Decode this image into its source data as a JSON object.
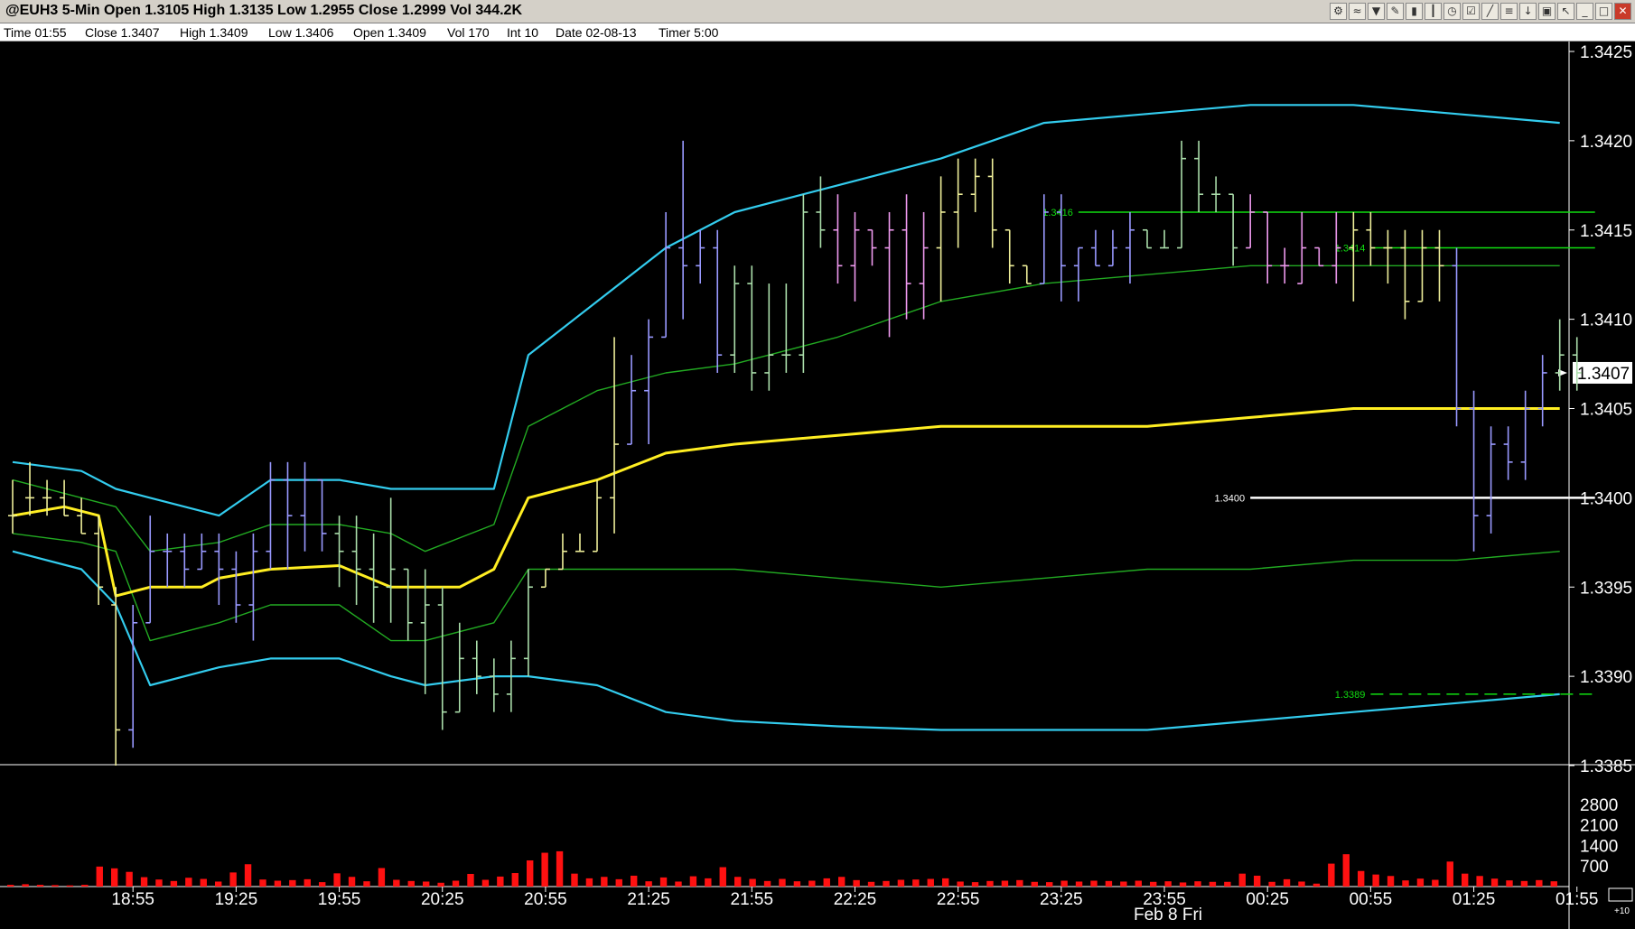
{
  "window": {
    "title": "@EUH3 5-Min Open 1.3105 High 1.3135 Low 1.2955 Close 1.2999 Vol 344.2K",
    "toolbar_icons": [
      "network-icon",
      "wave-icon",
      "filter-icon",
      "pencil-icon",
      "bar-chart-icon",
      "candlestick-icon",
      "clock-icon",
      "checklist-icon",
      "trendline-icon",
      "fib-icon",
      "down-arrow-icon",
      "trash-icon",
      "pointer-icon"
    ],
    "window_buttons": [
      "minimize-icon",
      "restore-icon",
      "close-icon"
    ]
  },
  "info": {
    "time": "Time 01:55",
    "close": "Close 1.3407",
    "high": "High 1.3409",
    "low": "Low 1.3406",
    "open": "Open 1.3409",
    "vol": "Vol 170",
    "int": "Int 10",
    "date": "Date 02-08-13",
    "timer": "Timer 5:00"
  },
  "colors": {
    "bg": "#000000",
    "cyan": "#33ccee",
    "green": "#22aa22",
    "yellow": "#ffee22",
    "bar_pink": "#ee99ee",
    "bar_blue": "#9999ff",
    "bar_yellow": "#eeee99",
    "bar_green": "#aaddaa",
    "volume": "#ff1111",
    "level_green": "#11dd11",
    "level_white": "#ffffff"
  },
  "chart_data": {
    "type": "ohlc",
    "ylim": [
      1.3385,
      1.3425
    ],
    "y_ticks": [
      "1.3425",
      "1.3420",
      "1.3415",
      "1.3410",
      "1.3405",
      "1.3400",
      "1.3395",
      "1.3390",
      "1.3385"
    ],
    "x_ticks": [
      "18:55",
      "19:25",
      "19:55",
      "20:25",
      "20:55",
      "21:25",
      "21:55",
      "22:25",
      "22:55",
      "23:25",
      "23:55",
      "00:25",
      "00:55",
      "01:25",
      "01:55"
    ],
    "x_tick_index": [
      7,
      13,
      19,
      25,
      31,
      37,
      43,
      49,
      55,
      61,
      67,
      73,
      79,
      85,
      91
    ],
    "date_label": "Feb 8 Fri",
    "last_price": "1.3407",
    "volume_ticks": [
      "2800",
      "2100",
      "1400",
      "700"
    ],
    "volume_ylim": [
      0,
      3500
    ],
    "corner_label": "+10",
    "bar_colors": "AAAAAAABBBBBBBBBBBBCCCCCCCCCCCCDDDDDDDDDDDDDDDDDDDDDDDDDDDDDDDDDDDDDDDDDDDDDDDDDDDDDDDDDDDD",
    "bars": [
      [
        1.3399,
        1.3401,
        1.3398,
        1.3399
      ],
      [
        1.34,
        1.3402,
        1.3399,
        1.34
      ],
      [
        1.34,
        1.3401,
        1.3399,
        1.34
      ],
      [
        1.34,
        1.3401,
        1.3399,
        1.3399
      ],
      [
        1.3399,
        1.34,
        1.3398,
        1.3398
      ],
      [
        1.3398,
        1.3399,
        1.3394,
        1.3395
      ],
      [
        1.3394,
        1.3395,
        1.3385,
        1.3387
      ],
      [
        1.3387,
        1.3394,
        1.3386,
        1.3393
      ],
      [
        1.3393,
        1.3399,
        1.3393,
        1.3397
      ],
      [
        1.3397,
        1.3398,
        1.3395,
        1.3397
      ],
      [
        1.3397,
        1.3398,
        1.3395,
        1.3396
      ],
      [
        1.3396,
        1.3398,
        1.3396,
        1.3397
      ],
      [
        1.3397,
        1.3398,
        1.3394,
        1.3396
      ],
      [
        1.3396,
        1.3397,
        1.3393,
        1.3394
      ],
      [
        1.3394,
        1.3398,
        1.3392,
        1.3397
      ],
      [
        1.3397,
        1.3402,
        1.3396,
        1.3401
      ],
      [
        1.3401,
        1.3402,
        1.3396,
        1.3399
      ],
      [
        1.3399,
        1.3402,
        1.3397,
        1.3401
      ],
      [
        1.3401,
        1.3401,
        1.3397,
        1.3398
      ],
      [
        1.3398,
        1.3399,
        1.3395,
        1.3397
      ],
      [
        1.3397,
        1.3399,
        1.3394,
        1.3396
      ],
      [
        1.3396,
        1.3398,
        1.3393,
        1.3395
      ],
      [
        1.3395,
        1.34,
        1.3393,
        1.3396
      ],
      [
        1.3396,
        1.3396,
        1.3392,
        1.3393
      ],
      [
        1.3393,
        1.3396,
        1.3389,
        1.3394
      ],
      [
        1.3394,
        1.3395,
        1.3387,
        1.3388
      ],
      [
        1.3388,
        1.3393,
        1.3388,
        1.3391
      ],
      [
        1.3391,
        1.3392,
        1.3389,
        1.339
      ],
      [
        1.339,
        1.3391,
        1.3388,
        1.3389
      ],
      [
        1.3389,
        1.3392,
        1.3388,
        1.3391
      ],
      [
        1.3391,
        1.3396,
        1.339,
        1.3395
      ],
      [
        1.3395,
        1.3396,
        1.3395,
        1.3396
      ],
      [
        1.3396,
        1.3398,
        1.3396,
        1.3397
      ],
      [
        1.3397,
        1.3398,
        1.3397,
        1.3397
      ],
      [
        1.3397,
        1.3401,
        1.3397,
        1.34
      ],
      [
        1.34,
        1.3409,
        1.3398,
        1.3403
      ],
      [
        1.3403,
        1.3408,
        1.3403,
        1.3406
      ],
      [
        1.3406,
        1.341,
        1.3403,
        1.3409
      ],
      [
        1.3409,
        1.3416,
        1.3409,
        1.3414
      ],
      [
        1.3414,
        1.342,
        1.341,
        1.3413
      ],
      [
        1.3413,
        1.3415,
        1.3412,
        1.3414
      ],
      [
        1.3414,
        1.3415,
        1.3407,
        1.3408
      ],
      [
        1.3408,
        1.3413,
        1.3407,
        1.3412
      ],
      [
        1.3412,
        1.3413,
        1.3406,
        1.3407
      ],
      [
        1.3407,
        1.3412,
        1.3406,
        1.3408
      ],
      [
        1.3408,
        1.3412,
        1.3407,
        1.3408
      ],
      [
        1.3408,
        1.3417,
        1.3407,
        1.3416
      ],
      [
        1.3416,
        1.3418,
        1.3414,
        1.3415
      ],
      [
        1.3415,
        1.3417,
        1.3412,
        1.3413
      ],
      [
        1.3413,
        1.3416,
        1.3411,
        1.3415
      ],
      [
        1.3415,
        1.3415,
        1.3413,
        1.3414
      ],
      [
        1.3414,
        1.3416,
        1.3409,
        1.3415
      ],
      [
        1.3415,
        1.3417,
        1.341,
        1.3412
      ],
      [
        1.3412,
        1.3416,
        1.341,
        1.3414
      ],
      [
        1.3414,
        1.3418,
        1.3411,
        1.3416
      ],
      [
        1.3416,
        1.3419,
        1.3414,
        1.3417
      ],
      [
        1.3417,
        1.3419,
        1.3416,
        1.3418
      ],
      [
        1.3418,
        1.3419,
        1.3414,
        1.3415
      ],
      [
        1.3415,
        1.3415,
        1.3412,
        1.3413
      ],
      [
        1.3413,
        1.3413,
        1.3412,
        1.3412
      ],
      [
        1.3412,
        1.3417,
        1.3412,
        1.3416
      ],
      [
        1.3416,
        1.3417,
        1.3411,
        1.3413
      ],
      [
        1.3413,
        1.3414,
        1.3411,
        1.3414
      ],
      [
        1.3414,
        1.3415,
        1.3413,
        1.3413
      ],
      [
        1.3413,
        1.3415,
        1.3413,
        1.3414
      ],
      [
        1.3414,
        1.3416,
        1.3412,
        1.3415
      ],
      [
        1.3415,
        1.3415,
        1.3414,
        1.3414
      ],
      [
        1.3414,
        1.3415,
        1.3414,
        1.3414
      ],
      [
        1.3414,
        1.342,
        1.3414,
        1.3419
      ],
      [
        1.3419,
        1.342,
        1.3416,
        1.3417
      ],
      [
        1.3417,
        1.3418,
        1.3416,
        1.3417
      ],
      [
        1.3417,
        1.3417,
        1.3413,
        1.3414
      ],
      [
        1.3414,
        1.3417,
        1.3414,
        1.3416
      ],
      [
        1.3416,
        1.3416,
        1.3412,
        1.3413
      ],
      [
        1.3413,
        1.3414,
        1.3412,
        1.3413
      ],
      [
        1.3412,
        1.3416,
        1.3412,
        1.3414
      ],
      [
        1.3414,
        1.3414,
        1.3413,
        1.3413
      ],
      [
        1.3413,
        1.3416,
        1.3412,
        1.3414
      ],
      [
        1.3414,
        1.3416,
        1.3411,
        1.3415
      ],
      [
        1.3415,
        1.3416,
        1.3413,
        1.3414
      ],
      [
        1.3414,
        1.3415,
        1.3412,
        1.3414
      ],
      [
        1.3414,
        1.3415,
        1.341,
        1.3411
      ],
      [
        1.3411,
        1.3415,
        1.3411,
        1.3414
      ],
      [
        1.3414,
        1.3415,
        1.3411,
        1.3413
      ],
      [
        1.3413,
        1.3414,
        1.3404,
        1.3405
      ],
      [
        1.3405,
        1.3406,
        1.3397,
        1.3399
      ],
      [
        1.3399,
        1.3404,
        1.3398,
        1.3403
      ],
      [
        1.3403,
        1.3404,
        1.3401,
        1.3402
      ],
      [
        1.3402,
        1.3406,
        1.3401,
        1.3405
      ],
      [
        1.3405,
        1.3408,
        1.3404,
        1.3407
      ],
      [
        1.3407,
        1.341,
        1.3406,
        1.3408
      ],
      [
        1.3408,
        1.3409,
        1.3406,
        1.3407
      ]
    ],
    "volume": [
      60,
      80,
      60,
      50,
      40,
      60,
      680,
      620,
      500,
      320,
      240,
      190,
      300,
      260,
      170,
      480,
      760,
      240,
      200,
      220,
      250,
      150,
      450,
      330,
      180,
      630,
      230,
      190,
      170,
      130,
      200,
      430,
      230,
      340,
      460,
      890,
      1150,
      1200,
      440,
      280,
      330,
      250,
      370,
      180,
      310,
      170,
      350,
      280,
      660,
      330,
      260,
      190,
      260,
      180,
      200,
      280,
      330,
      220,
      160,
      190,
      230,
      240,
      260,
      280,
      170,
      150,
      190,
      200,
      220,
      160,
      150,
      200,
      170,
      200,
      190,
      170,
      200,
      160,
      180,
      140,
      180,
      160,
      160,
      440,
      370,
      160,
      250,
      170,
      100,
      780,
      1100,
      530,
      410,
      360,
      210,
      270,
      230,
      850,
      440,
      360,
      270,
      210,
      190,
      220,
      180
    ],
    "ma_mid": [
      [
        0,
        1.3399
      ],
      [
        3,
        1.33995
      ],
      [
        5,
        1.3399
      ],
      [
        6,
        1.33945
      ],
      [
        8,
        1.3395
      ],
      [
        11,
        1.3395
      ],
      [
        12,
        1.33955
      ],
      [
        15,
        1.3396
      ],
      [
        19,
        1.33962
      ],
      [
        22,
        1.3395
      ],
      [
        24,
        1.3395
      ],
      [
        26,
        1.3395
      ],
      [
        28,
        1.3396
      ],
      [
        30,
        1.34
      ],
      [
        34,
        1.3401
      ],
      [
        38,
        1.34025
      ],
      [
        42,
        1.3403
      ],
      [
        48,
        1.34035
      ],
      [
        54,
        1.3404
      ],
      [
        60,
        1.3404
      ],
      [
        66,
        1.3404
      ],
      [
        72,
        1.34045
      ],
      [
        78,
        1.3405
      ],
      [
        84,
        1.3405
      ],
      [
        90,
        1.3405
      ]
    ],
    "bb_inner_upper": [
      [
        0,
        1.3401
      ],
      [
        4,
        1.34
      ],
      [
        6,
        1.33995
      ],
      [
        8,
        1.3397
      ],
      [
        12,
        1.33975
      ],
      [
        15,
        1.33985
      ],
      [
        19,
        1.33985
      ],
      [
        22,
        1.3398
      ],
      [
        24,
        1.3397
      ],
      [
        28,
        1.33985
      ],
      [
        30,
        1.3404
      ],
      [
        34,
        1.3406
      ],
      [
        38,
        1.3407
      ],
      [
        42,
        1.34075
      ],
      [
        48,
        1.3409
      ],
      [
        54,
        1.3411
      ],
      [
        60,
        1.3412
      ],
      [
        66,
        1.34125
      ],
      [
        72,
        1.3413
      ],
      [
        78,
        1.3413
      ],
      [
        84,
        1.3413
      ],
      [
        90,
        1.3413
      ]
    ],
    "bb_inner_lower": [
      [
        0,
        1.3398
      ],
      [
        4,
        1.33975
      ],
      [
        6,
        1.3397
      ],
      [
        8,
        1.3392
      ],
      [
        12,
        1.3393
      ],
      [
        15,
        1.3394
      ],
      [
        19,
        1.3394
      ],
      [
        22,
        1.3392
      ],
      [
        24,
        1.3392
      ],
      [
        28,
        1.3393
      ],
      [
        30,
        1.3396
      ],
      [
        34,
        1.3396
      ],
      [
        38,
        1.3396
      ],
      [
        42,
        1.3396
      ],
      [
        48,
        1.33955
      ],
      [
        54,
        1.3395
      ],
      [
        60,
        1.33955
      ],
      [
        66,
        1.3396
      ],
      [
        72,
        1.3396
      ],
      [
        78,
        1.33965
      ],
      [
        84,
        1.33965
      ],
      [
        90,
        1.3397
      ]
    ],
    "bb_outer_upper": [
      [
        0,
        1.3402
      ],
      [
        4,
        1.34015
      ],
      [
        6,
        1.34005
      ],
      [
        8,
        1.34
      ],
      [
        12,
        1.3399
      ],
      [
        15,
        1.3401
      ],
      [
        19,
        1.3401
      ],
      [
        22,
        1.34005
      ],
      [
        24,
        1.34005
      ],
      [
        28,
        1.34005
      ],
      [
        30,
        1.3408
      ],
      [
        34,
        1.3411
      ],
      [
        38,
        1.3414
      ],
      [
        42,
        1.3416
      ],
      [
        48,
        1.34175
      ],
      [
        54,
        1.3419
      ],
      [
        60,
        1.3421
      ],
      [
        66,
        1.34215
      ],
      [
        72,
        1.3422
      ],
      [
        78,
        1.3422
      ],
      [
        84,
        1.34215
      ],
      [
        90,
        1.3421
      ]
    ],
    "bb_outer_lower": [
      [
        0,
        1.3397
      ],
      [
        4,
        1.3396
      ],
      [
        6,
        1.3394
      ],
      [
        8,
        1.33895
      ],
      [
        12,
        1.33905
      ],
      [
        15,
        1.3391
      ],
      [
        19,
        1.3391
      ],
      [
        22,
        1.339
      ],
      [
        24,
        1.33895
      ],
      [
        28,
        1.339
      ],
      [
        30,
        1.339
      ],
      [
        34,
        1.33895
      ],
      [
        38,
        1.3388
      ],
      [
        42,
        1.33875
      ],
      [
        48,
        1.33872
      ],
      [
        54,
        1.3387
      ],
      [
        60,
        1.3387
      ],
      [
        66,
        1.3387
      ],
      [
        72,
        1.33875
      ],
      [
        78,
        1.3388
      ],
      [
        84,
        1.33885
      ],
      [
        90,
        1.3389
      ]
    ],
    "levels": [
      {
        "label": "1.3416",
        "value": 1.3416,
        "from": 62,
        "color": "#11dd11",
        "dash": false
      },
      {
        "label": "1.3414",
        "value": 1.3414,
        "from": 79,
        "color": "#11dd11",
        "dash": false
      },
      {
        "label": "1.3400",
        "value": 1.34,
        "from": 72,
        "color": "#ffffff",
        "dash": false
      },
      {
        "label": "1.3389",
        "value": 1.3389,
        "from": 79,
        "color": "#11dd11",
        "dash": true
      }
    ]
  }
}
